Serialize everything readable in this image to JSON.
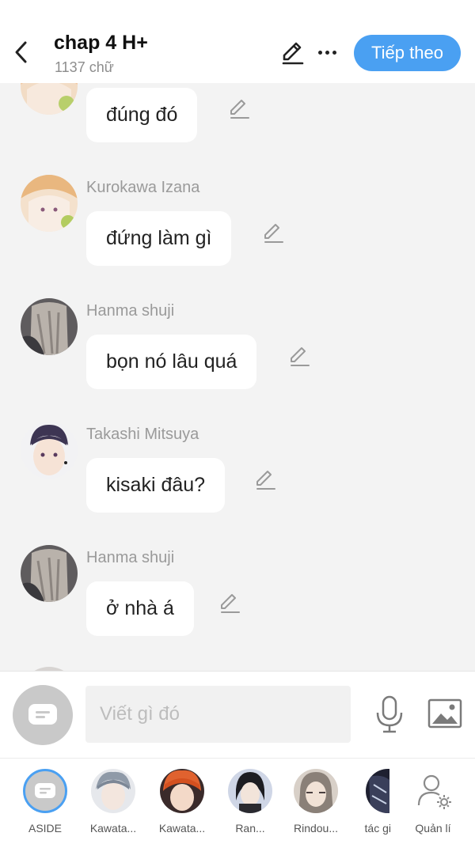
{
  "header": {
    "title": "chap 4 H+",
    "word_count": "1137 chữ",
    "next_button": "Tiếp theo"
  },
  "messages": [
    {
      "sender": "",
      "text": "đúng đó",
      "avatar": "kurokawa-izana-avatar"
    },
    {
      "sender": "Kurokawa Izana",
      "text": "đứng làm gì",
      "avatar": "kurokawa-izana-avatar"
    },
    {
      "sender": "Hanma shuji",
      "text": "bọn nó lâu quá",
      "avatar": "hanma-shuji-avatar"
    },
    {
      "sender": "Takashi Mitsuya",
      "text": "kisaki đâu?",
      "avatar": "takashi-mitsuya-avatar"
    },
    {
      "sender": "Hanma shuji",
      "text": "ở nhà á",
      "avatar": "hanma-shuji-avatar"
    }
  ],
  "compose": {
    "placeholder": "Viết gì đó",
    "icons": [
      "aside-toggle-icon",
      "microphone-icon",
      "image-icon"
    ]
  },
  "characters": [
    {
      "label": "ASIDE",
      "selected": true
    },
    {
      "label": "Kawata..."
    },
    {
      "label": "Kawata..."
    },
    {
      "label": "Ran..."
    },
    {
      "label": "Rindou..."
    },
    {
      "label": "tác gi"
    },
    {
      "label": "Quản lí"
    }
  ],
  "colors": {
    "accent": "#4aa0f2",
    "background": "#f3f3f3",
    "bubble": "#ffffff",
    "sender_text": "#9a9a9a"
  }
}
